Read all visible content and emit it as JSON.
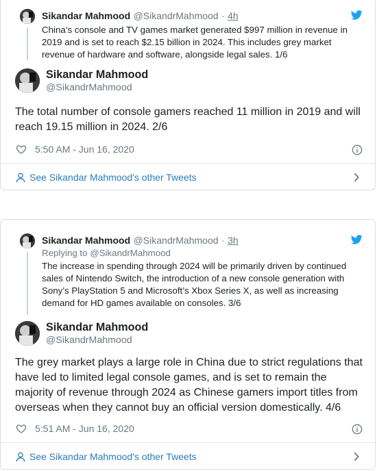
{
  "accent": "#1da1f2",
  "link_color": "#2b7bb9",
  "tweets": [
    {
      "parent": {
        "name": "Sikandar Mahmood",
        "handle": "@SikandrMahmood",
        "sep": "·",
        "time": "4h",
        "text": "China’s console and TV games market generated $997 million in revenue in 2019 and is set to reach $2.15 billion in 2024. This includes grey market revenue of hardware and software, alongside legal sales. 1/6"
      },
      "main": {
        "name": "Sikandar Mahmood",
        "handle": "@SikandrMahmood",
        "text": "The total number of console gamers reached 11 million in 2019 and will reach 19.15 million in 2024. 2/6",
        "timestamp": "5:50 AM - Jun 16, 2020"
      },
      "see_more": "See Sikandar Mahmood's other Tweets"
    },
    {
      "parent": {
        "name": "Sikandar Mahmood",
        "handle": "@SikandrMahmood",
        "sep": "·",
        "time": "3h",
        "replying": "Replying to @SikandrMahmood",
        "text": "The increase in spending through 2024 will be primarily driven by continued sales of Nintendo Switch, the introduction of a new console generation with Sony’s PlayStation 5 and Microsoft’s Xbox Series X, as well as increasing demand for HD games available on consoles. 3/6"
      },
      "main": {
        "name": "Sikandar Mahmood",
        "handle": "@SikandrMahmood",
        "text": "The grey market plays a large role in China due to strict regulations that have led to limited legal console games, and is set to remain the majority of revenue through 2024 as Chinese gamers import titles from overseas when they cannot buy an official version domestically. 4/6",
        "timestamp": "5:51 AM - Jun 16, 2020"
      },
      "see_more": "See Sikandar Mahmood's other Tweets"
    }
  ],
  "icons": [
    "twitter-bird-icon",
    "heart-icon",
    "info-icon",
    "person-icon",
    "chevron-right-icon"
  ]
}
